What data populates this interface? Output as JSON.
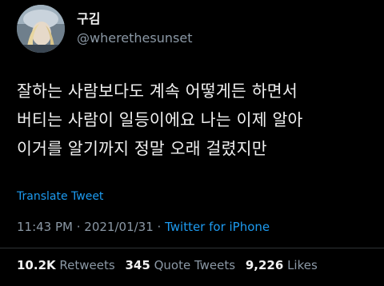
{
  "user": {
    "display_name": "구김",
    "handle": "@wherethesunset"
  },
  "tweet": {
    "lines": [
      "잘하는 사람보다도 계속 어떻게든 하면서",
      "버티는 사람이 일등이에요 나는 이제 알아",
      "이거를 알기까지 정말 오래 걸렸지만"
    ],
    "translate_label": "Translate Tweet",
    "time": "11:43 PM",
    "date": "2021/01/31",
    "source": "Twitter for iPhone",
    "separator": " · "
  },
  "stats": {
    "retweets_count": "10.2K",
    "retweets_label": "Retweets",
    "quotes_count": "345",
    "quotes_label": "Quote Tweets",
    "likes_count": "9,226",
    "likes_label": "Likes"
  },
  "colors": {
    "background": "#000000",
    "link": "#1d9bf0",
    "muted": "#8b98a5",
    "text": "#f2f2f2"
  }
}
